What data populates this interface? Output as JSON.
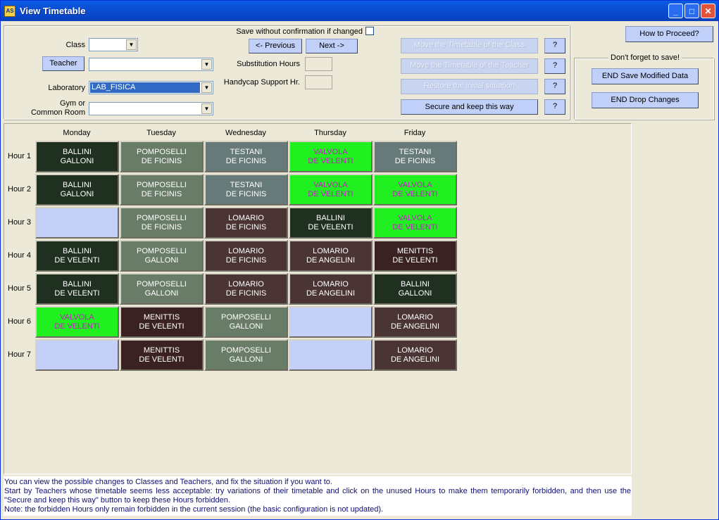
{
  "window": {
    "title": "View Timetable",
    "icon": "app-icon"
  },
  "top": {
    "class_label": "Class",
    "class_value": "",
    "teacher_button": "Teacher",
    "teacher_value": "",
    "laboratory_label": "Laboratory",
    "laboratory_value": "LAB_FISICA",
    "gym_label_1": "Gym or",
    "gym_label_2": "Common Room",
    "gym_value": "",
    "save_without_confirm": "Save without confirmation if changed",
    "previous": "<- Previous",
    "next": "Next ->",
    "substitution_hours": "Substitution Hours",
    "handycap_support": "Handycap Support Hr.",
    "move_class": "Move the Timetable of the Class",
    "move_teacher": "Move the Timetable of the Teacher",
    "restore": "Restore the initial situation",
    "secure": "Secure and keep this way",
    "help": "?",
    "how_to_proceed": "How to Proceed?",
    "dont_forget": "Don't forget to save!",
    "end_save": "END Save Modified Data",
    "end_drop": "END Drop Changes"
  },
  "days": [
    "Monday",
    "Tuesday",
    "Wednesday",
    "Thursday",
    "Friday"
  ],
  "hours": [
    "Hour 1",
    "Hour 2",
    "Hour 3",
    "Hour 4",
    "Hour 5",
    "Hour 6",
    "Hour 7"
  ],
  "timetable": [
    [
      {
        "l1": "BALLINI",
        "l2": "GALLONI",
        "c": "dg"
      },
      {
        "l1": "POMPOSELLI",
        "l2": "DE FICINIS",
        "c": "mg"
      },
      {
        "l1": "TESTANI",
        "l2": "DE FICINIS",
        "c": "sg"
      },
      {
        "l1": "VALVOLA",
        "l2": "DE VELENTI",
        "c": "lg"
      },
      {
        "l1": "TESTANI",
        "l2": "DE FICINIS",
        "c": "sg"
      }
    ],
    [
      {
        "l1": "BALLINI",
        "l2": "GALLONI",
        "c": "dg"
      },
      {
        "l1": "POMPOSELLI",
        "l2": "DE FICINIS",
        "c": "mg"
      },
      {
        "l1": "TESTANI",
        "l2": "DE FICINIS",
        "c": "sg"
      },
      {
        "l1": "VALVOLA",
        "l2": "DE VELENTI",
        "c": "lg"
      },
      {
        "l1": "VALVOLA",
        "l2": "DE VELENTI",
        "c": "lg"
      }
    ],
    [
      {
        "l1": "",
        "l2": "",
        "c": "eb"
      },
      {
        "l1": "POMPOSELLI",
        "l2": "DE FICINIS",
        "c": "mg"
      },
      {
        "l1": "LOMARIO",
        "l2": "DE FICINIS",
        "c": "br"
      },
      {
        "l1": "BALLINI",
        "l2": "DE VELENTI",
        "c": "dg"
      },
      {
        "l1": "VALVOLA",
        "l2": "DE VELENTI",
        "c": "lg"
      }
    ],
    [
      {
        "l1": "BALLINI",
        "l2": "DE VELENTI",
        "c": "dg"
      },
      {
        "l1": "POMPOSELLI",
        "l2": "GALLONI",
        "c": "mg"
      },
      {
        "l1": "LOMARIO",
        "l2": "DE FICINIS",
        "c": "br"
      },
      {
        "l1": "LOMARIO",
        "l2": "DE ANGELINI",
        "c": "br"
      },
      {
        "l1": "MENITTIS",
        "l2": "DE VELENTI",
        "c": "db"
      }
    ],
    [
      {
        "l1": "BALLINI",
        "l2": "DE VELENTI",
        "c": "dg"
      },
      {
        "l1": "POMPOSELLI",
        "l2": "GALLONI",
        "c": "mg"
      },
      {
        "l1": "LOMARIO",
        "l2": "DE FICINIS",
        "c": "br"
      },
      {
        "l1": "LOMARIO",
        "l2": "DE ANGELINI",
        "c": "br"
      },
      {
        "l1": "BALLINI",
        "l2": "GALLONI",
        "c": "dg"
      }
    ],
    [
      {
        "l1": "VALVOLA",
        "l2": "DE VELENTI",
        "c": "lg"
      },
      {
        "l1": "MENITTIS",
        "l2": "DE VELENTI",
        "c": "db"
      },
      {
        "l1": "POMPOSELLI",
        "l2": "GALLONI",
        "c": "mg"
      },
      {
        "l1": "",
        "l2": "",
        "c": "eb"
      },
      {
        "l1": "LOMARIO",
        "l2": "DE ANGELINI",
        "c": "br"
      }
    ],
    [
      {
        "l1": "",
        "l2": "",
        "c": "eb"
      },
      {
        "l1": "MENITTIS",
        "l2": "DE VELENTI",
        "c": "db"
      },
      {
        "l1": "POMPOSELLI",
        "l2": "GALLONI",
        "c": "mg"
      },
      {
        "l1": "",
        "l2": "",
        "c": "eb"
      },
      {
        "l1": "LOMARIO",
        "l2": "DE ANGELINI",
        "c": "br"
      }
    ]
  ],
  "footer": {
    "line1": "You can view the possible changes to Classes and Teachers, and fix the situation if you want to.",
    "line2": "Start by Teachers whose timetable seems less acceptable: try variations of their timetable and click on the unused Hours to make them temporarily forbidden, and then use the \"Secure and keep this way\" button to keep these Hours forbidden.",
    "line3": "Note: the forbidden Hours only remain forbidden in the current session (the basic configuration is not updated)."
  }
}
